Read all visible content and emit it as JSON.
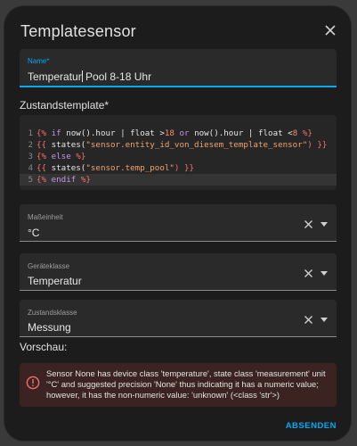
{
  "dialog": {
    "title": "Templatesensor",
    "name_field": {
      "label": "Name*",
      "value_before_caret": "Temperatur",
      "value_after_caret": " Pool 8-18 Uhr"
    },
    "template_label": "Zustandstemplate*",
    "code_lines": [
      {
        "number": "1"
      },
      {
        "number": "2"
      },
      {
        "number": "3"
      },
      {
        "number": "4"
      },
      {
        "number": "5"
      }
    ],
    "code_tokens": {
      "l1_open": "{%",
      "l1_if": " if ",
      "l1_now1": "now().hour | float >",
      "l1_n18": "18",
      "l1_or": " or ",
      "l1_now2": "now().hour | float <",
      "l1_n8": "8",
      "l1_close": " %}",
      "l2_open": "{{ ",
      "l2_fn": "states(",
      "l2_str": "\"sensor.entity_id_von_diesem_template_sensor\"",
      "l2_close": ") }}",
      "l3_open": "{%",
      "l3_else": " else ",
      "l3_close": "%}",
      "l4_open": "{{ ",
      "l4_fn": "states(",
      "l4_str": "\"sensor.temp_pool\"",
      "l4_close": ") }}",
      "l5_open": "{%",
      "l5_endif": " endif ",
      "l5_close": "%}"
    },
    "unit_field": {
      "label": "Maßeinheit",
      "value": "°C"
    },
    "device_class_field": {
      "label": "Geräteklasse",
      "value": "Temperatur"
    },
    "state_class_field": {
      "label": "Zustandsklasse",
      "value": "Messung"
    },
    "preview_label": "Vorschau:",
    "alert_message": "Sensor None has device class 'temperature', state class 'measurement' unit '°C' and suggested precision 'None' thus indicating it has a numeric value; however, it has the non-numeric value: 'unknown' (<class 'str'>)",
    "submit_label": "ABSENDEN"
  },
  "colors": {
    "accent": "#03a9f4",
    "error": "#f0716b",
    "surface": "#1c1c1c",
    "field": "#2a2a2a"
  },
  "icons": {
    "close": "close-icon",
    "clear": "clear-icon",
    "dropdown": "dropdown-arrow-icon",
    "alert": "alert-circle-icon"
  }
}
